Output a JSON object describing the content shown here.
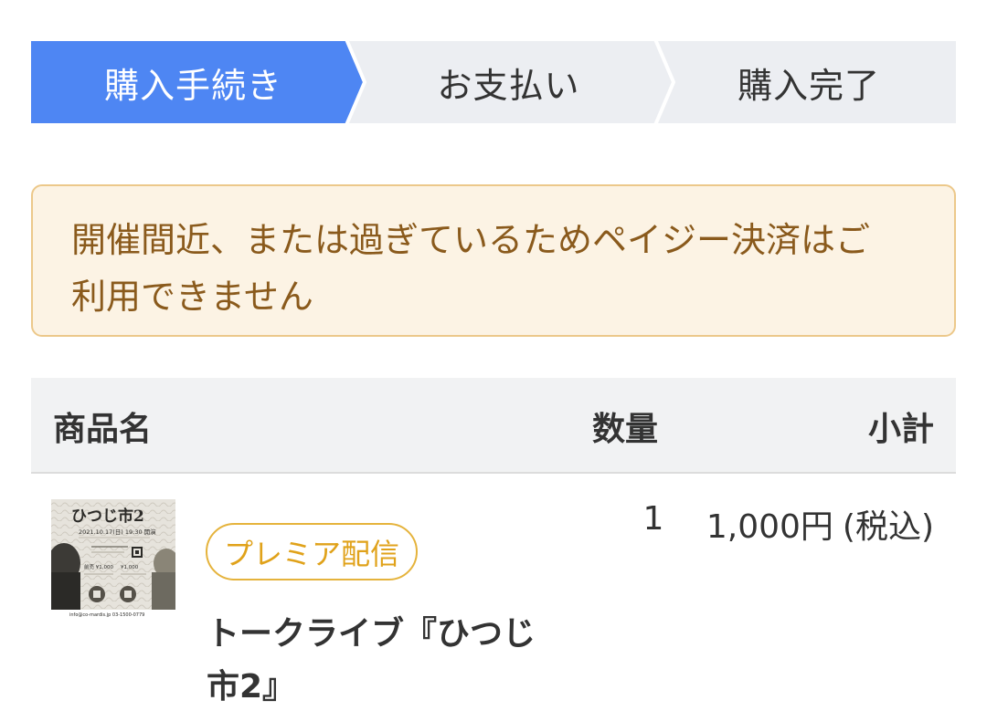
{
  "stepper": {
    "steps": [
      {
        "label": "購入手続き",
        "active": true
      },
      {
        "label": "お支払い",
        "active": false
      },
      {
        "label": "購入完了",
        "active": false
      }
    ],
    "colors": {
      "active": "#4e86f3",
      "inactive": "#eceef2"
    }
  },
  "alert": {
    "line1": "開催間近、または過ぎているためペイジー決済はご",
    "line2": "利用できません"
  },
  "table": {
    "headers": {
      "name": "商品名",
      "quantity": "数量",
      "subtotal": "小計"
    },
    "rows": [
      {
        "badge": "プレミア配信",
        "name": "トークライブ『ひつじ市2』",
        "quantity": "1",
        "price": "1,000円",
        "tax_note": "(税込)",
        "thumbnail": {
          "title": "ひつじ市2",
          "date": "2021.10.17(日) 19:30 開演",
          "price_line1": "前売 ¥1,000",
          "price_line2": "¥1,000",
          "contact": "info@co-mardis.jp  03-1500-0779"
        }
      }
    ]
  }
}
